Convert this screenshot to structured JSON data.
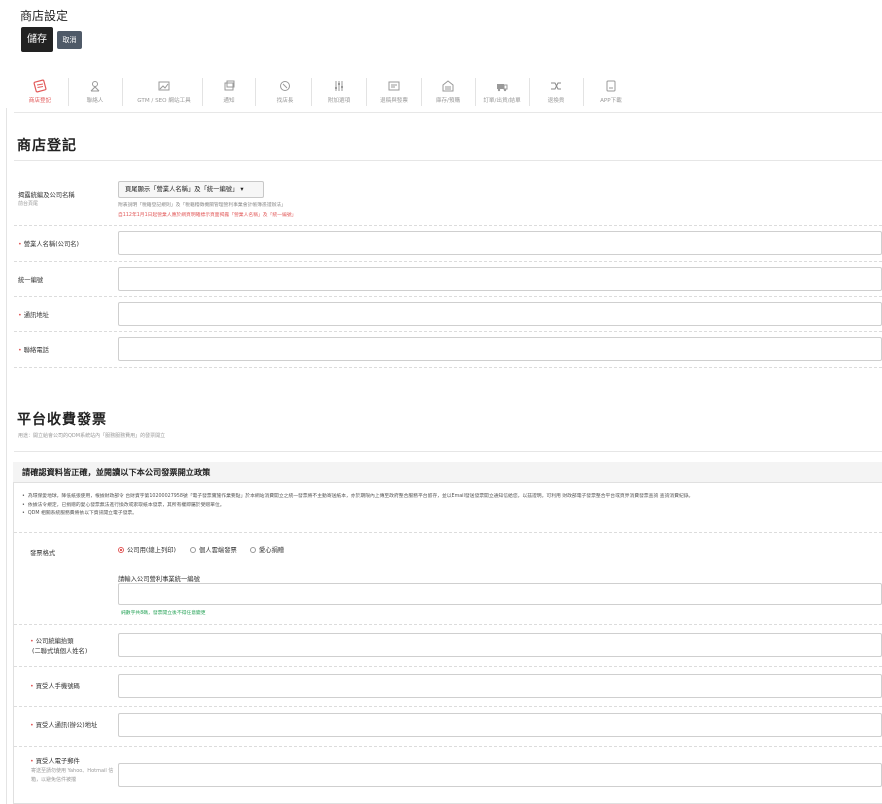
{
  "header": {
    "title": "商店設定",
    "save": "儲存",
    "cancel": "取消"
  },
  "tabs": [
    {
      "label": "商店登記",
      "icon": "register-icon",
      "active": true
    },
    {
      "label": "聯絡人",
      "icon": "contact-icon"
    },
    {
      "label": "GTM / SEO 網站工具",
      "icon": "seo-image-icon"
    },
    {
      "label": "通知",
      "icon": "notification-icon"
    },
    {
      "label": "找店長",
      "icon": "find-manager-icon"
    },
    {
      "label": "附加選項",
      "icon": "options-sliders-icon"
    },
    {
      "label": "退稿與發票",
      "icon": "invoice-icon"
    },
    {
      "label": "庫存/預購",
      "icon": "warehouse-icon"
    },
    {
      "label": "訂單/出貨/結單",
      "icon": "orders-icon"
    },
    {
      "label": "退換貨",
      "icon": "shuffle-icon"
    },
    {
      "label": "APP下載",
      "icon": "app-download-icon"
    }
  ],
  "store": {
    "title": "商店登記",
    "display_label": "揭露統編及公司名稱",
    "display_sub": "前台頁尾",
    "display_select": "頁尾顯示「營業人名稱」及「統一編號」",
    "note1": "附表說明「稅籍登記規則」及「稅籍稽徵機關管理營利事業會計帳簿憑證辦法」",
    "note2": "自112年1月1日起營業人應於網頁明確標示頁面揭露「營業人名稱」及「統一編號」",
    "company_label": "營業人名稱(公司名)",
    "tax_id_label": "統一編號",
    "address_label": "通訊地址",
    "phone_label": "聯絡電話"
  },
  "billing": {
    "title": "平台收費發票",
    "subtitle": "用途：開立給會公司的QDM系統站內「服務服務費用」的發票開立",
    "panel_title": "請確認資料皆正確，並閱讀以下本公司發票開立政策",
    "bullets": [
      "為環保愛地球，降低紙張使用，根據財政部令 台財資字第10200027958號「電子發票實施作業要點」於本網站消費開立之統一發票將不主動寄送紙本，亦於期限內上傳至政府整合服務平台留存，並以Email發送發票開立通知信給您，以茲證明。可利用 財政部電子發票整合平台或頁界消費發票查詢 查詢消費紀錄。",
      "依據法令規定，已捐贈的愛心發票無法進行換改或索取紙本發票，其所有權即屬於受贈單位。",
      "QDM 相關系統服務費將依以下資訊開立電子發票。"
    ],
    "format_label": "發票格式",
    "options": [
      "公司用(總上列印)",
      "個人雲端發票",
      "愛心捐贈"
    ],
    "selected": 0,
    "tax_prompt": "請輸入公司營利事業統一編號",
    "tax_hint": "純數字共8碼，發票開立後不得任意變更",
    "title_label": "公司統編抬頭",
    "title_sub": "(二聯式填個人姓名)",
    "mobile_label": "買受人手機號碼",
    "buyer_addr_label": "買受人通訊(辦公)地址",
    "email_label": "買受人電子郵件",
    "email_note": "寄送至請勿使用 Yahoo、Hotmail 信箱，以避免信件被擋"
  }
}
